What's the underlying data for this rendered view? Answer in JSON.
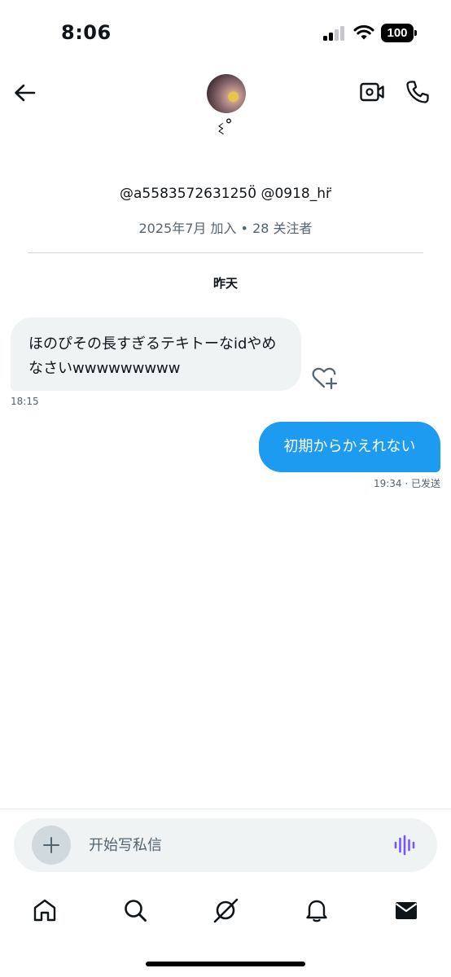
{
  "status_bar": {
    "time": "8:06",
    "battery": "100",
    "icons": [
      "signal-icon",
      "wifi-icon",
      "battery-icon"
    ]
  },
  "header": {
    "display_name": "ଽ˚",
    "icons": [
      "back-arrow-icon",
      "video-call-icon",
      "phone-icon"
    ]
  },
  "profile": {
    "handles": "@a5583572631250̈ @0918_hr̈",
    "meta": "2025年7月 加入 • 28 关注者"
  },
  "conversation": {
    "date_separator": "昨天",
    "messages": [
      {
        "direction": "incoming",
        "text": "ほのぴその長すぎるテキトーなidやめなさいwwwwwwwww",
        "time": "18:15"
      },
      {
        "direction": "outgoing",
        "text": "初期からかえれない",
        "time": "19:34 · 已发送"
      }
    ]
  },
  "composer": {
    "placeholder": "开始写私信",
    "icons": [
      "plus-icon",
      "voice-message-icon"
    ]
  },
  "bottom_nav": {
    "items": [
      "home-icon",
      "search-icon",
      "grok-icon",
      "notifications-icon",
      "messages-icon"
    ],
    "active": "messages-icon"
  },
  "colors": {
    "accent": "#1d9bf0",
    "incoming_bubble": "#eff3f4",
    "secondary_text": "#536471",
    "voice_icon": "#7856ff"
  }
}
